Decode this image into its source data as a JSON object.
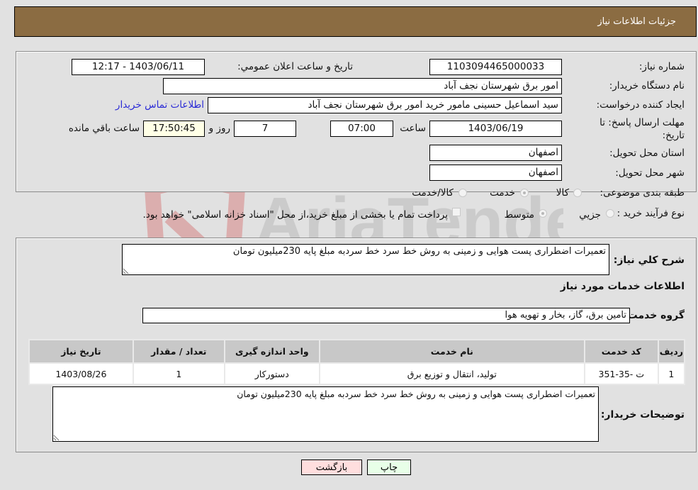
{
  "header": {
    "title": "جزئیات اطلاعات نیاز"
  },
  "details": {
    "need_number_label": "شماره نیاز:",
    "need_number": "1103094465000033",
    "announce_label": "تاریخ و ساعت اعلان عمومي:",
    "announce_value": "1403/06/11 - 12:17",
    "buyer_org_label": "نام دستگاه خریدار:",
    "buyer_org": "امور برق شهرستان نجف آباد",
    "creator_label": "ایجاد کننده درخواست:",
    "creator": "سید اسماعیل  حسینی  مامور خرید  امور برق شهرستان نجف آباد",
    "contact_link": "اطلاعات تماس خریدار",
    "deadline_label": "مهلت ارسال پاسخ: تا تاریخ:",
    "deadline_date": "1403/06/19",
    "time_label": "ساعت",
    "deadline_time": "07:00",
    "days_value": "7",
    "days_label": "روز و",
    "remaining_time": "17:50:45",
    "remaining_label": "ساعت باقي مانده",
    "province_label": "استان محل تحویل:",
    "province": "اصفهان",
    "city_label": "شهر محل تحویل:",
    "city": "اصفهان",
    "category_label": "طبقه بندی موضوعی:",
    "category_options": [
      {
        "label": "کالا",
        "selected": false
      },
      {
        "label": "خدمت",
        "selected": true
      },
      {
        "label": "کالا/خدمت",
        "selected": false
      }
    ],
    "process_label": "نوع فرآیند خرید :",
    "process_options": [
      {
        "label": "جزیي",
        "selected": false
      },
      {
        "label": "متوسط",
        "selected": true
      }
    ],
    "treasury_checkbox_label": "پرداخت تمام یا بخشی از مبلغ خرید،از محل \"اسناد خزانه اسلامی\" خواهد بود.",
    "treasury_checked": false
  },
  "summary": {
    "description_label": "شرح کلي نیاز:",
    "description": "تعمیرات اضطراری پست هوایی و زمینی به روش خط سرد خط سردبه مبلغ پایه 230میلیون تومان",
    "services_heading": "اطلاعات خدمات مورد نیاز",
    "service_group_label": "گروه خدمت:",
    "service_group": "تامین برق، گاز، بخار و تهویه هوا",
    "table": {
      "columns": [
        "ردیف",
        "کد خدمت",
        "نام خدمت",
        "واحد اندازه گیری",
        "تعداد / مقدار",
        "تاریخ نیاز"
      ],
      "rows": [
        [
          "1",
          "ت -35-351",
          "تولید، انتقال و توزیع برق",
          "دستورکار",
          "1",
          "1403/08/26"
        ]
      ]
    },
    "buyer_notes_label": "توضیحات خریدار:",
    "buyer_notes": "تعمیرات اضطراری پست هوایی و زمینی به روش خط سرد خط سردبه مبلغ پایه 230میلیون تومان"
  },
  "buttons": {
    "back": "بازگشت",
    "print": "چاپ"
  },
  "watermark": {
    "text": "AriaTender.neT"
  },
  "colors": {
    "header_bg": "#8b6c42",
    "back_bg": "#ffdede",
    "print_bg": "#e8ffe8",
    "link": "#2a2ad6"
  }
}
